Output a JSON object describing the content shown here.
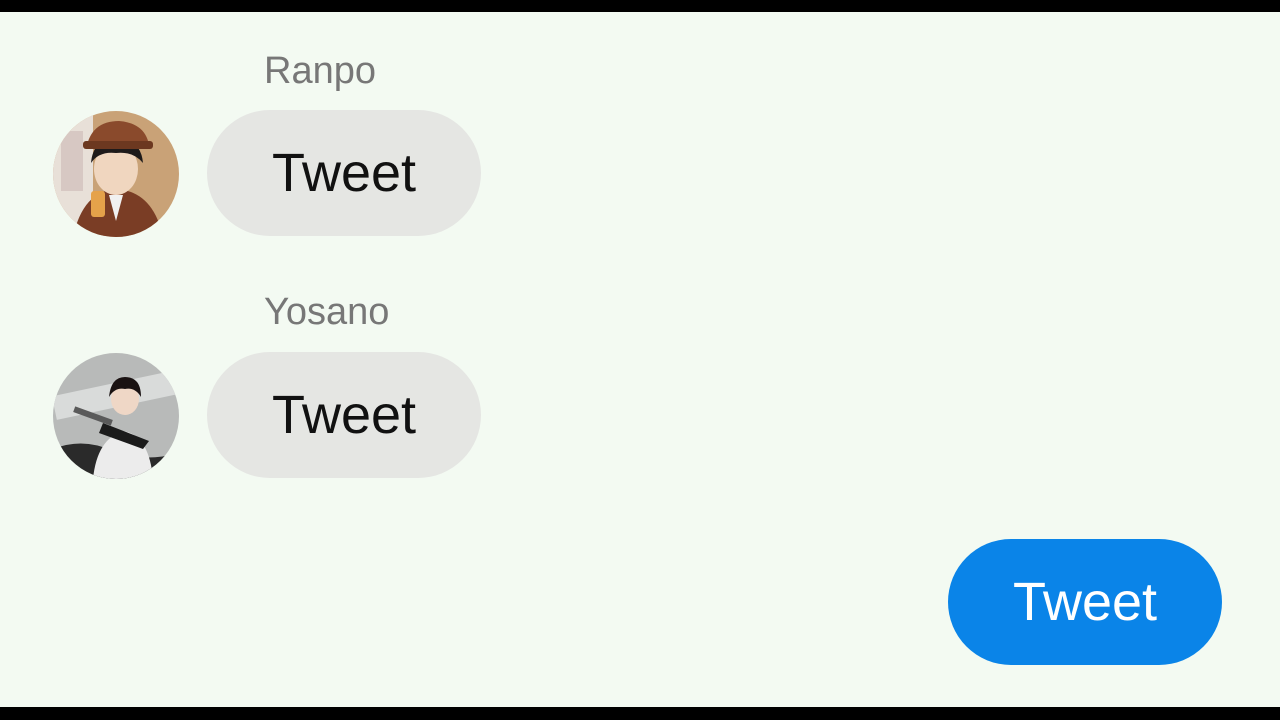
{
  "messages": [
    {
      "sender": "Ranpo",
      "text": "Tweet",
      "direction": "incoming",
      "avatar_icon": "ranpo-avatar-icon"
    },
    {
      "sender": "Yosano",
      "text": "Tweet",
      "direction": "incoming",
      "avatar_icon": "yosano-avatar-icon"
    },
    {
      "sender": "",
      "text": "Tweet",
      "direction": "outgoing"
    }
  ],
  "colors": {
    "background": "#f3faf2",
    "incoming_bubble": "#e5e6e3",
    "outgoing_bubble": "#0a84e8",
    "sender_name": "#777777"
  }
}
